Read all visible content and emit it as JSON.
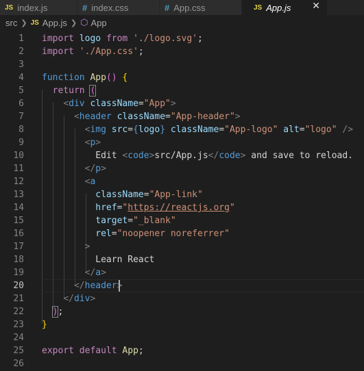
{
  "tabs": [
    {
      "icon": "JS",
      "label": "index.js",
      "active": false
    },
    {
      "icon": "#",
      "label": "index.css",
      "active": false
    },
    {
      "icon": "#",
      "label": "App.css",
      "active": false
    },
    {
      "icon": "JS",
      "label": "App.js",
      "active": true,
      "close": "✕"
    }
  ],
  "breadcrumb": {
    "folder": "src",
    "file_icon": "JS",
    "file": "App.js",
    "symbol": "App"
  },
  "editor": {
    "current_line": 20,
    "line_numbers": [
      "1",
      "2",
      "3",
      "4",
      "5",
      "6",
      "7",
      "8",
      "9",
      "10",
      "11",
      "12",
      "13",
      "14",
      "15",
      "16",
      "17",
      "18",
      "19",
      "20",
      "21",
      "22",
      "23",
      "24",
      "25",
      "26"
    ],
    "code": {
      "l1": [
        "import",
        "logo",
        "from",
        "'./logo.svg'",
        ";"
      ],
      "l2": [
        "import",
        "'./App.css'",
        ";"
      ],
      "l4": [
        "function",
        "App",
        "()",
        "{"
      ],
      "l5": [
        "return",
        "("
      ],
      "l6": [
        "<",
        "div",
        "className",
        "=",
        "\"App\"",
        ">"
      ],
      "l7": [
        "<",
        "header",
        "className",
        "=",
        "\"App-header\"",
        ">"
      ],
      "l8": [
        "<",
        "img",
        "src",
        "=",
        "{",
        "logo",
        "}",
        "className",
        "=",
        "\"App-logo\"",
        "alt",
        "=",
        "\"logo\"",
        "/>"
      ],
      "l9": [
        "<",
        "p",
        ">"
      ],
      "l10": [
        "Edit ",
        "<",
        "code",
        ">",
        "src/App.js",
        "</",
        "code",
        ">",
        " and save to reload."
      ],
      "l11": [
        "</",
        "p",
        ">"
      ],
      "l12": [
        "<",
        "a"
      ],
      "l13": [
        "className",
        "=",
        "\"App-link\""
      ],
      "l14": [
        "href",
        "=",
        "\"",
        "https://reactjs.org",
        "\""
      ],
      "l15": [
        "target",
        "=",
        "\"_blank\""
      ],
      "l16": [
        "rel",
        "=",
        "\"noopener noreferrer\""
      ],
      "l17": [
        ">"
      ],
      "l18": [
        "Learn React"
      ],
      "l19": [
        "</",
        "a",
        ">"
      ],
      "l20": [
        "</",
        "header",
        ">"
      ],
      "l21": [
        "</",
        "div",
        ">"
      ],
      "l22": [
        ")",
        ";"
      ],
      "l23": [
        "}"
      ],
      "l25": [
        "export",
        "default",
        "App",
        ";"
      ]
    }
  }
}
